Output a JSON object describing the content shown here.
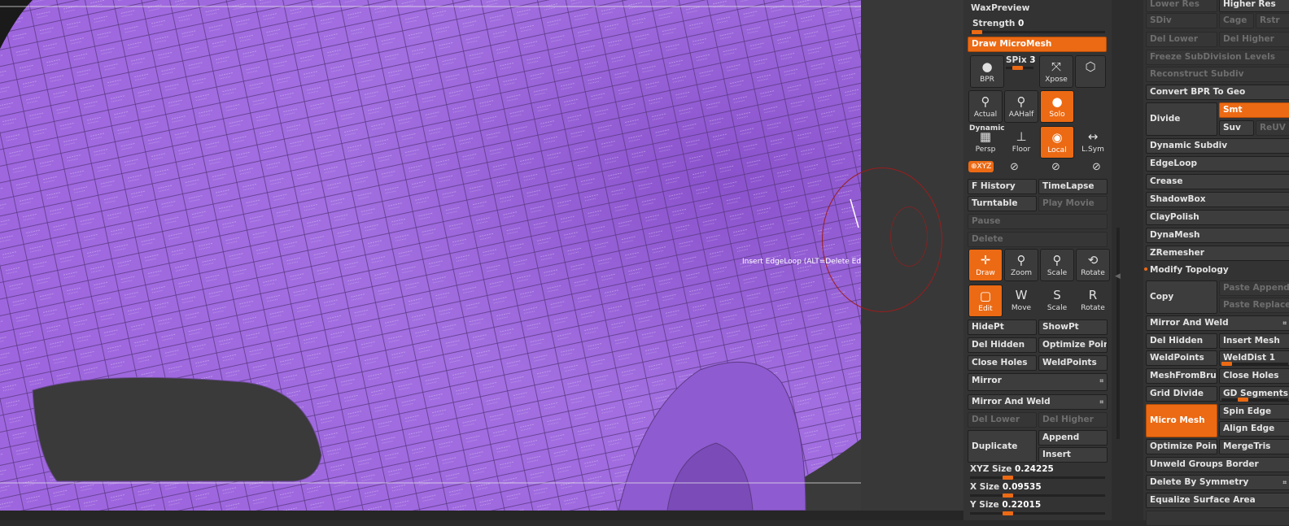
{
  "viewport": {
    "tooltip": "Insert EdgeLoop (ALT=Delete Ed",
    "mesh_color": "#9a62dc"
  },
  "shelf": {
    "wax_preview": "WaxPreview",
    "strength_label": "Strength",
    "strength_value": "0",
    "draw_micromesh": "Draw MicroMesh",
    "bpr": "BPR",
    "spix_label": "SPix",
    "spix_value": "3",
    "xpose": "Xpose",
    "actual": "Actual",
    "aahalf": "AAHalf",
    "solo": "Solo",
    "dynamic": "Dynamic",
    "persp": "Persp",
    "floor": "Floor",
    "local": "Local",
    "lsym": "L.Sym",
    "xyz": "XYZ",
    "f_history": "F History",
    "timelapse": "TimeLapse",
    "turntable": "Turntable",
    "play_movie": "Play Movie",
    "pause": "Pause",
    "delete": "Delete",
    "draw": "Draw",
    "zoom": "Zoom",
    "scale": "Scale",
    "rotate": "Rotate",
    "edit": "Edit",
    "move": "Move",
    "scale2": "Scale",
    "rotate2": "Rotate",
    "hidept": "HidePt",
    "showpt": "ShowPt",
    "del_hidden": "Del Hidden",
    "optimize_poin": "Optimize Poin",
    "close_holes": "Close Holes",
    "weldpoints": "WeldPoints",
    "mirror": "Mirror",
    "mirror_weld": "Mirror And Weld",
    "del_lower": "Del Lower",
    "del_higher": "Del Higher",
    "duplicate": "Duplicate",
    "append": "Append",
    "insert": "Insert",
    "xyz_size_label": "XYZ Size",
    "xyz_size_value": "0.24225",
    "x_size_label": "X Size",
    "x_size_value": "0.09535",
    "y_size_label": "Y Size",
    "y_size_value": "0.22015"
  },
  "tool": {
    "lower_res": "Lower Res",
    "higher_res": "Higher Res",
    "sdiv": "SDiv",
    "cage": "Cage",
    "rstr": "Rstr",
    "del_lower": "Del Lower",
    "del_higher": "Del Higher",
    "freeze": "Freeze SubDivision Levels",
    "reconstruct": "Reconstruct Subdiv",
    "convert_bpr": "Convert BPR To Geo",
    "divide": "Divide",
    "smt": "Smt",
    "suv": "Suv",
    "reuv": "ReUV",
    "dynamic_subdiv": "Dynamic Subdiv",
    "edgeloop": "EdgeLoop",
    "crease": "Crease",
    "shadowbox": "ShadowBox",
    "claypolish": "ClayPolish",
    "dynamesh": "DynaMesh",
    "zremesher": "ZRemesher",
    "modify_topology": "Modify Topology",
    "copy": "Copy",
    "paste_append": "Paste Append",
    "paste_replace": "Paste Replace",
    "mirror_weld": "Mirror And Weld",
    "del_hidden": "Del Hidden",
    "insert_mesh": "Insert Mesh",
    "weldpoints": "WeldPoints",
    "welddist_label": "WeldDist",
    "welddist_value": "1",
    "meshfrombrush": "MeshFromBrush",
    "close_holes": "Close Holes",
    "grid_divide": "Grid Divide",
    "gd_segments": "GD Segments",
    "micro_mesh": "Micro Mesh",
    "spin_edge": "Spin Edge",
    "align_edge": "Align Edge",
    "optimize_poin": "Optimize Poin",
    "mergetris": "MergeTris",
    "unweld": "Unweld Groups Border",
    "delete_symmetry": "Delete By Symmetry",
    "equalize": "Equalize Surface Area"
  },
  "colors": {
    "accent": "#ec6a14",
    "panel": "#333333",
    "viewport_bg": "#3a3a3a"
  }
}
